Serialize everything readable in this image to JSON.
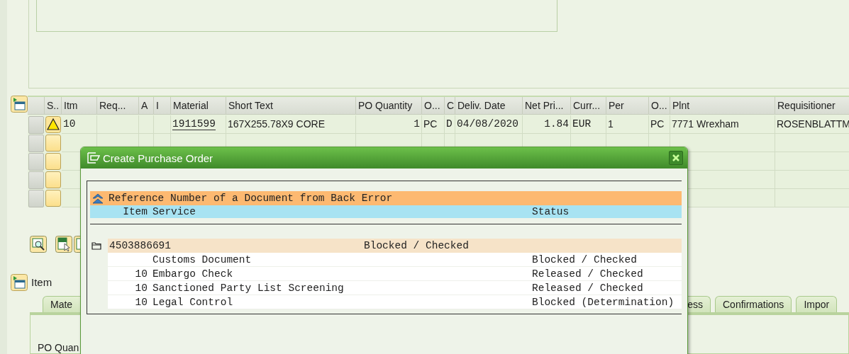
{
  "items_table": {
    "columns": [
      "S..",
      "Itm",
      "Req...",
      "A",
      "I",
      "Material",
      "Short Text",
      "PO Quantity",
      "O...",
      "C",
      "Deliv. Date",
      "Net Pri...",
      "Curr...",
      "Per",
      "O...",
      "Plnt",
      "Requisitioner"
    ],
    "rows": [
      {
        "kind": "warning",
        "cells": [
          "10",
          null,
          null,
          null,
          "1911599",
          "167X255.78X9 CORE",
          "1",
          "PC",
          "D",
          "04/08/2020",
          "1.84",
          "EUR",
          "1",
          "PC",
          "7771 Wrexham",
          "ROSENBLATTM"
        ]
      },
      {
        "kind": "empty"
      },
      {
        "kind": "empty"
      },
      {
        "kind": "empty"
      },
      {
        "kind": "empty"
      }
    ]
  },
  "item_section": {
    "title": "Item",
    "tabs": [
      {
        "label": "Mate"
      },
      {
        "label": "ess"
      },
      {
        "label": "Confirmations"
      },
      {
        "label": "Impor"
      }
    ],
    "field_label": "PO Quan"
  },
  "dialog": {
    "title": "Create Purchase Order",
    "header": "Reference Number of a Document from Back Error",
    "columns": [
      "Item",
      "Service",
      "Status"
    ],
    "documents": [
      {
        "number": "4503886691",
        "status": "Blocked / Checked",
        "children": [
          {
            "service": "Customs Document",
            "status": "Blocked / Checked"
          },
          {
            "item": "10",
            "service": "Embargo Check",
            "status": "Released / Checked"
          },
          {
            "item": "10",
            "service": "Sanctioned Party List Screening",
            "status": "Released / Checked"
          },
          {
            "item": "10",
            "service": "Legal Control",
            "status": "Blocked (Determination)"
          }
        ]
      }
    ]
  }
}
